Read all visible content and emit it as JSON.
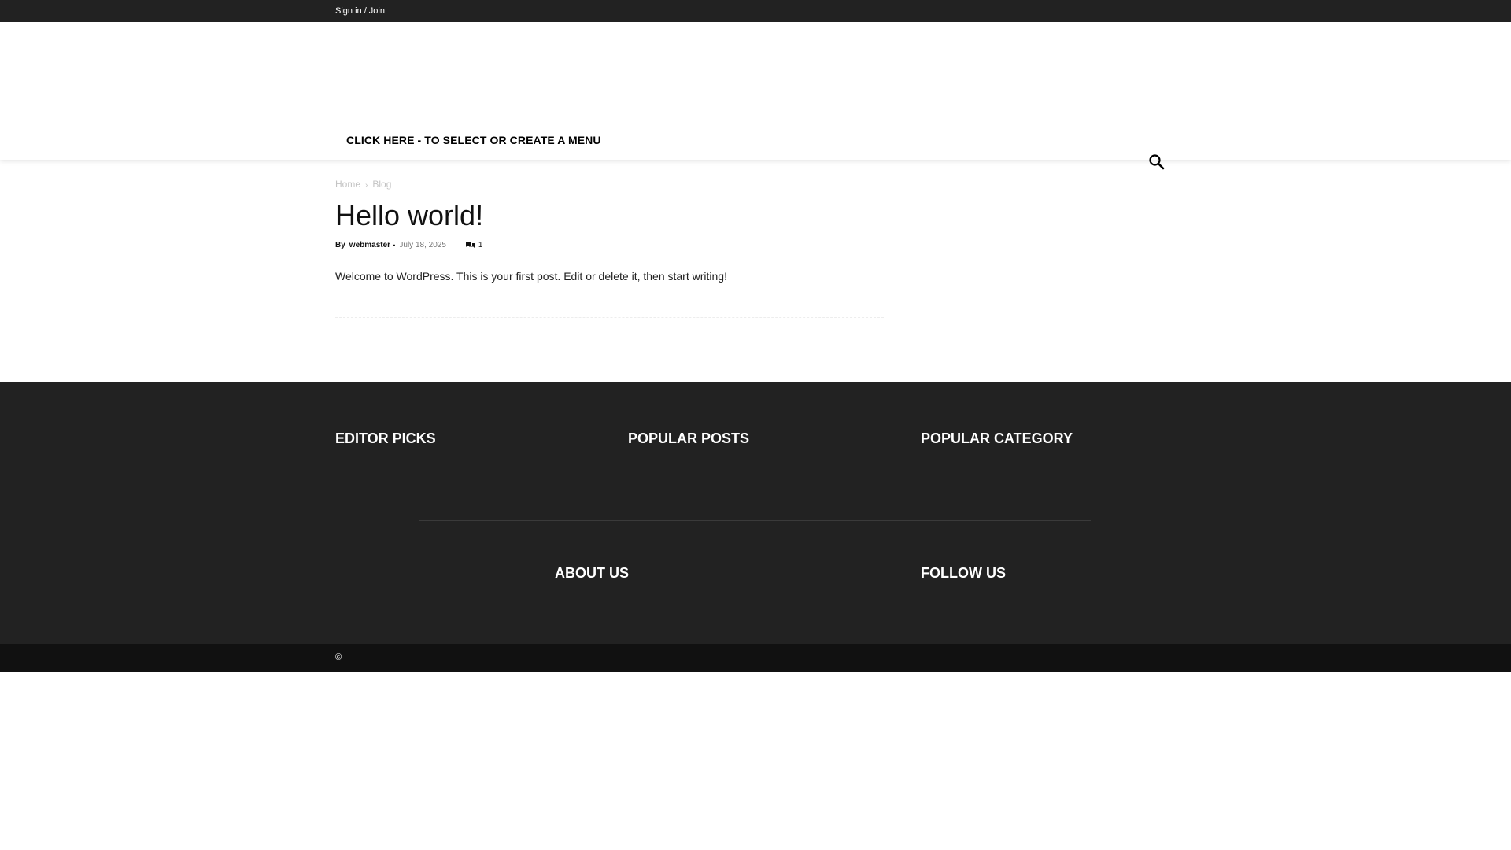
{
  "topbar": {
    "signin_label": "Sign in / Join"
  },
  "header": {
    "menu_label": "CLICK HERE - TO SELECT OR CREATE A MENU",
    "search_icon": "search-icon"
  },
  "breadcrumb": {
    "items": [
      "Home",
      "Blog"
    ],
    "separator": "›"
  },
  "post": {
    "title": "Hello world!",
    "by": "By",
    "author": "webmaster",
    "dash": "-",
    "date": "July 18, 2025",
    "comment_icon": "comment-icon",
    "comment_count": "1",
    "body": "Welcome to WordPress. This is your first post. Edit or delete it, then start writing!"
  },
  "footer": {
    "editor_picks": "EDITOR PICKS",
    "popular_posts": "POPULAR POSTS",
    "popular_category": "POPULAR CATEGORY",
    "about_us": "ABOUT US",
    "follow_us": "FOLLOW US"
  },
  "bottombar": {
    "copyright": "©"
  },
  "colors": {
    "topbar": "#222222",
    "footer": "#222222",
    "bottombar": "#111111"
  }
}
